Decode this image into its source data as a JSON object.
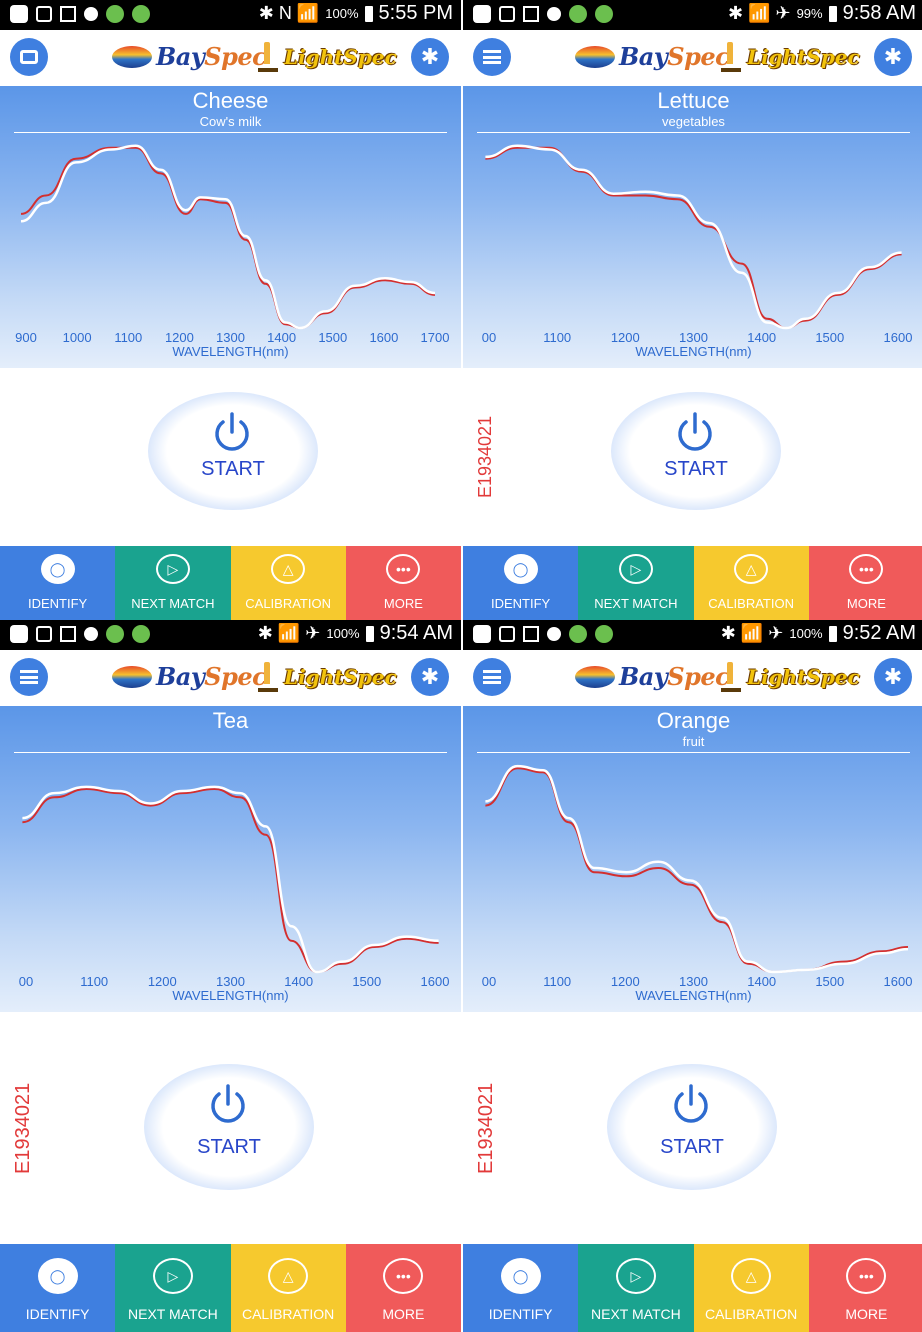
{
  "panels": [
    {
      "status_time": "5:55 PM",
      "status_battery": "100%",
      "status_symbols": "✱ N 📶",
      "left_button": "printer-icon",
      "title": "Cheese",
      "subtitle": "Cow's milk",
      "serial": "",
      "start_label": "START",
      "nav": {
        "identify": "IDENTIFY",
        "next": "NEXT MATCH",
        "calib": "CALIBRATION",
        "more": "MORE"
      },
      "chart_data": {
        "type": "line",
        "xlabel": "WAVELENGTH(nm)",
        "xlim": [
          860,
          1720
        ],
        "x_ticks": [
          "900",
          "1000",
          "1100",
          "1200",
          "1300",
          "1400",
          "1500",
          "1600",
          "1700"
        ],
        "series": [
          {
            "color": "#d32f2f",
            "x": [
              870,
              920,
              980,
              1050,
              1100,
              1150,
              1200,
              1230,
              1280,
              1320,
              1360,
              1400,
              1430,
              1480,
              1540,
              1600,
              1650,
              1700
            ],
            "y": [
              0.62,
              0.72,
              0.92,
              0.98,
              0.98,
              0.84,
              0.62,
              0.7,
              0.68,
              0.48,
              0.24,
              0.02,
              0.0,
              0.08,
              0.22,
              0.26,
              0.24,
              0.18
            ]
          },
          {
            "color": "#ffffff",
            "x": [
              870,
              920,
              980,
              1050,
              1100,
              1150,
              1200,
              1230,
              1280,
              1320,
              1360,
              1400,
              1430,
              1480,
              1540,
              1600,
              1650,
              1700
            ],
            "y": [
              0.58,
              0.68,
              0.9,
              0.97,
              0.99,
              0.86,
              0.64,
              0.71,
              0.7,
              0.5,
              0.26,
              0.03,
              0.0,
              0.09,
              0.23,
              0.27,
              0.25,
              0.19
            ]
          }
        ]
      }
    },
    {
      "status_time": "9:58 AM",
      "status_battery": "99%",
      "status_symbols": "✱ 📶 ✈",
      "left_button": "menu-icon",
      "title": "Lettuce",
      "subtitle": "vegetables",
      "serial": "E1934021",
      "start_label": "START",
      "nav": {
        "identify": "IDENTIFY",
        "next": "NEXT MATCH",
        "calib": "CALIBRATION",
        "more": "MORE"
      },
      "chart_data": {
        "type": "line",
        "xlabel": "WAVELENGTH(nm)",
        "xlim": [
          990,
          1660
        ],
        "x_ticks": [
          "00",
          "1100",
          "1200",
          "1300",
          "1400",
          "1500",
          "1600"
        ],
        "series": [
          {
            "color": "#d32f2f",
            "x": [
              1000,
              1050,
              1100,
              1150,
              1200,
              1250,
              1300,
              1350,
              1400,
              1440,
              1470,
              1500,
              1550,
              1600,
              1650
            ],
            "y": [
              0.92,
              0.98,
              0.98,
              0.85,
              0.72,
              0.72,
              0.7,
              0.55,
              0.35,
              0.05,
              0.0,
              0.04,
              0.18,
              0.32,
              0.4
            ]
          },
          {
            "color": "#ffffff",
            "x": [
              1000,
              1050,
              1100,
              1150,
              1200,
              1250,
              1300,
              1350,
              1400,
              1440,
              1470,
              1500,
              1550,
              1600,
              1650
            ],
            "y": [
              0.93,
              0.99,
              0.97,
              0.86,
              0.73,
              0.74,
              0.72,
              0.57,
              0.3,
              0.03,
              0.0,
              0.05,
              0.19,
              0.33,
              0.41
            ]
          }
        ]
      }
    },
    {
      "status_time": "9:54 AM",
      "status_battery": "100%",
      "status_symbols": "✱ 📶 ✈",
      "left_button": "menu-icon",
      "title": "Tea",
      "subtitle": "",
      "serial": "E1934021",
      "start_label": "START",
      "nav": {
        "identify": "IDENTIFY",
        "next": "NEXT MATCH",
        "calib": "CALIBRATION",
        "more": "MORE"
      },
      "chart_data": {
        "type": "line",
        "xlabel": "WAVELENGTH(nm)",
        "xlim": [
          990,
          1660
        ],
        "x_ticks": [
          "00",
          "1100",
          "1200",
          "1300",
          "1400",
          "1500",
          "1600"
        ],
        "series": [
          {
            "color": "#d32f2f",
            "x": [
              1000,
              1050,
              1100,
              1150,
              1200,
              1250,
              1300,
              1340,
              1380,
              1420,
              1460,
              1500,
              1550,
              1600,
              1650
            ],
            "y": [
              0.72,
              0.84,
              0.88,
              0.86,
              0.8,
              0.86,
              0.88,
              0.84,
              0.66,
              0.15,
              0.0,
              0.04,
              0.12,
              0.16,
              0.14
            ]
          },
          {
            "color": "#ffffff",
            "x": [
              1000,
              1050,
              1100,
              1150,
              1200,
              1250,
              1300,
              1340,
              1380,
              1420,
              1460,
              1500,
              1550,
              1600,
              1650
            ],
            "y": [
              0.74,
              0.86,
              0.89,
              0.87,
              0.81,
              0.87,
              0.89,
              0.86,
              0.7,
              0.22,
              0.0,
              0.05,
              0.13,
              0.17,
              0.15
            ]
          }
        ]
      }
    },
    {
      "status_time": "9:52 AM",
      "status_battery": "100%",
      "status_symbols": "✱ 📶 ✈",
      "left_button": "menu-icon",
      "title": "Orange",
      "subtitle": "fruit",
      "serial": "E1934021",
      "start_label": "START",
      "nav": {
        "identify": "IDENTIFY",
        "next": "NEXT MATCH",
        "calib": "CALIBRATION",
        "more": "MORE"
      },
      "chart_data": {
        "type": "line",
        "xlabel": "WAVELENGTH(nm)",
        "xlim": [
          990,
          1660
        ],
        "x_ticks": [
          "00",
          "1100",
          "1200",
          "1300",
          "1400",
          "1500",
          "1600"
        ],
        "series": [
          {
            "color": "#d32f2f",
            "x": [
              1000,
              1050,
              1090,
              1130,
              1170,
              1220,
              1270,
              1320,
              1370,
              1410,
              1450,
              1500,
              1560,
              1620,
              1660
            ],
            "y": [
              0.8,
              0.98,
              0.96,
              0.72,
              0.48,
              0.46,
              0.5,
              0.42,
              0.24,
              0.04,
              0.0,
              0.01,
              0.05,
              0.1,
              0.12
            ]
          },
          {
            "color": "#ffffff",
            "x": [
              1000,
              1050,
              1090,
              1130,
              1170,
              1220,
              1270,
              1320,
              1370,
              1410,
              1450,
              1500,
              1560,
              1620,
              1660
            ],
            "y": [
              0.82,
              0.99,
              0.97,
              0.74,
              0.5,
              0.48,
              0.53,
              0.44,
              0.26,
              0.05,
              0.0,
              0.01,
              0.04,
              0.09,
              0.11
            ]
          }
        ]
      }
    }
  ]
}
